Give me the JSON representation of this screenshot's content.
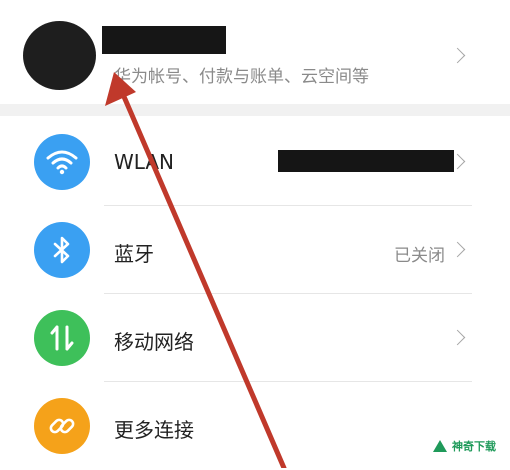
{
  "account": {
    "subtitle": "华为帐号、付款与账单、云空间等"
  },
  "settings": {
    "items": [
      {
        "label": "WLAN",
        "value": "",
        "icon": "wifi-icon",
        "color": "#3aa0f2"
      },
      {
        "label": "蓝牙",
        "value": "已关闭",
        "icon": "bluetooth-icon",
        "color": "#3aa0f2"
      },
      {
        "label": "移动网络",
        "value": "",
        "icon": "mobile-data-icon",
        "color": "#3ec05a"
      },
      {
        "label": "更多连接",
        "value": "",
        "icon": "link-icon",
        "color": "#f5a21a"
      }
    ]
  },
  "watermark": {
    "text": "神奇下载"
  },
  "colors": {
    "annotation_arrow": "#c0392b"
  }
}
